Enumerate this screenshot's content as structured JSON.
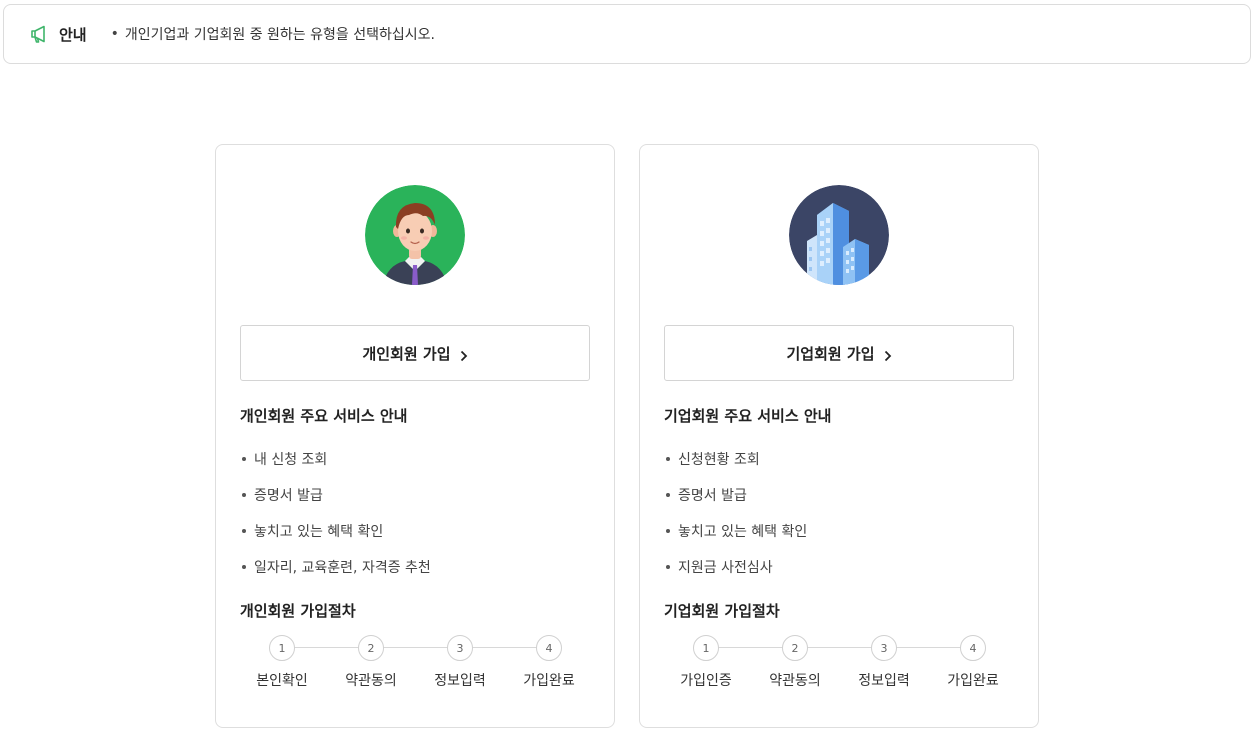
{
  "notice": {
    "title": "안내",
    "bullet": "•",
    "text": "개인기업과 기업회원 중 원하는 유형을 선택하십시오."
  },
  "personal": {
    "avatar_icon": "person-avatar-icon",
    "join_label": "개인회원 가입",
    "service_title": "개인회원 주요 서비스 안내",
    "services": [
      "내 신청 조회",
      "증명서 발급",
      "놓치고 있는 혜택 확인",
      "일자리, 교육훈련, 자격증 추천"
    ],
    "steps_title": "개인회원 가입절차",
    "steps": [
      {
        "num": "1",
        "label": "본인확인"
      },
      {
        "num": "2",
        "label": "약관동의"
      },
      {
        "num": "3",
        "label": "정보입력"
      },
      {
        "num": "4",
        "label": "가입완료"
      }
    ]
  },
  "company": {
    "avatar_icon": "building-avatar-icon",
    "join_label": "기업회원 가입",
    "service_title": "기업회원 주요 서비스 안내",
    "services": [
      "신청현황 조회",
      "증명서 발급",
      "놓치고 있는 혜택 확인",
      "지원금 사전심사"
    ],
    "steps_title": "기업회원 가입절차",
    "steps": [
      {
        "num": "1",
        "label": "가입인증"
      },
      {
        "num": "2",
        "label": "약관동의"
      },
      {
        "num": "3",
        "label": "정보입력"
      },
      {
        "num": "4",
        "label": "가입완료"
      }
    ]
  },
  "colors": {
    "notice_icon": "#3fb56b",
    "personal_avatar_bg": "#2ab35a",
    "company_avatar_bg": "#3b4566",
    "border": "#dedede"
  }
}
